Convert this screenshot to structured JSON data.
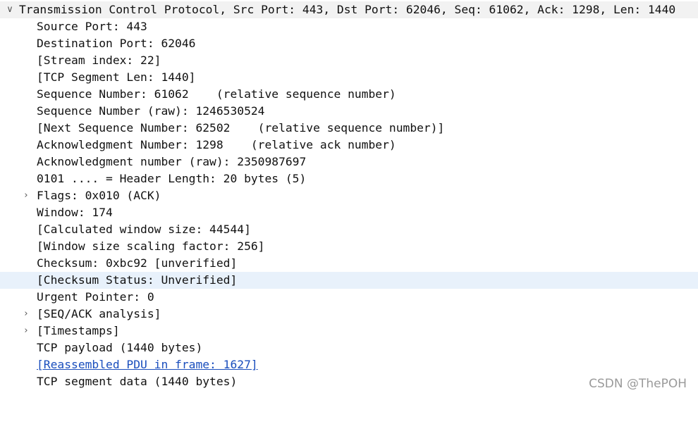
{
  "tree": {
    "root": {
      "label": "Transmission Control Protocol, Src Port: 443, Dst Port: 62046, Seq: 61062, Ack: 1298, Len: 1440",
      "toggle": "∨"
    },
    "fields": [
      "Source Port: 443",
      "Destination Port: 62046",
      "[Stream index: 22]",
      "[TCP Segment Len: 1440]",
      "Sequence Number: 61062    (relative sequence number)",
      "Sequence Number (raw): 1246530524",
      "[Next Sequence Number: 62502    (relative sequence number)]",
      "Acknowledgment Number: 1298    (relative ack number)",
      "Acknowledgment number (raw): 2350987697",
      "0101 .... = Header Length: 20 bytes (5)",
      "Flags: 0x010 (ACK)",
      "Window: 174",
      "[Calculated window size: 44544]",
      "[Window size scaling factor: 256]",
      "Checksum: 0xbc92 [unverified]",
      "[Checksum Status: Unverified]",
      "Urgent Pointer: 0",
      "[SEQ/ACK analysis]",
      "[Timestamps]",
      "TCP payload (1440 bytes)",
      "[Reassembled PDU in frame: 1627]",
      "TCP segment data (1440 bytes)"
    ],
    "expand_glyph": "›"
  },
  "watermark": "CSDN @ThePOH"
}
